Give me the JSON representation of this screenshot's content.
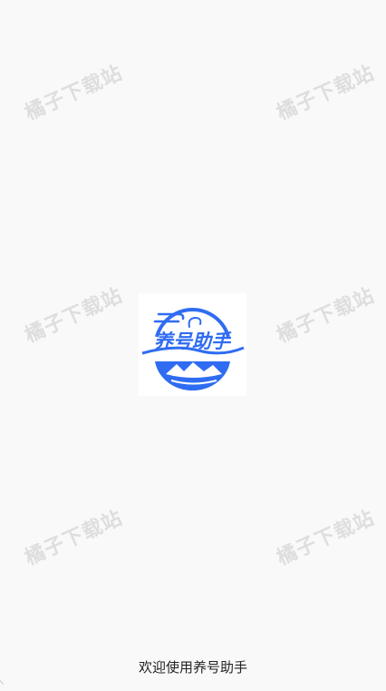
{
  "watermark": {
    "text": "橘子下载站"
  },
  "logo": {
    "brand_text": "养号助手",
    "icon": "app-logo-icon",
    "accent_color": "#2f6cf2"
  },
  "splash": {
    "welcome_text": "欢迎使用养号助手"
  }
}
